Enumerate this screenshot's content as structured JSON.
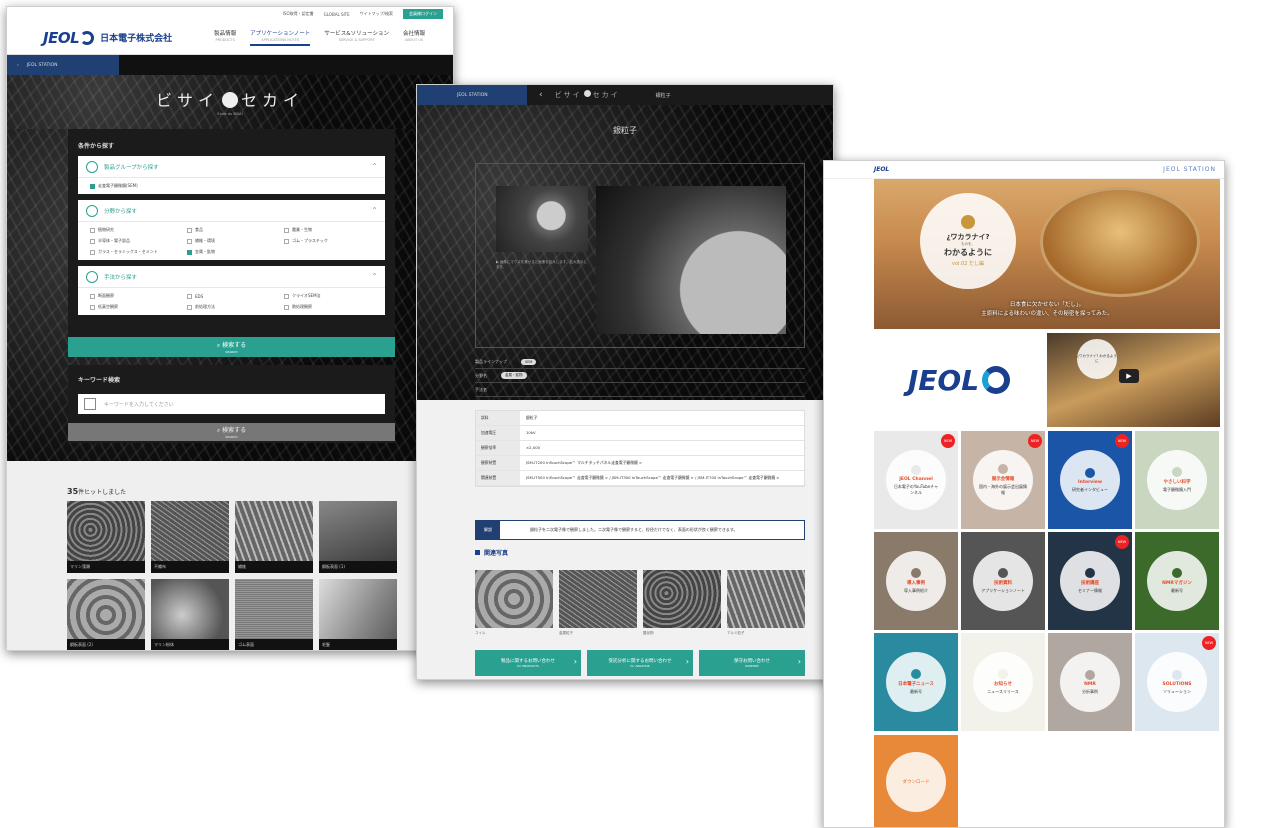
{
  "shot1": {
    "utility": [
      "ISO取得・認定書",
      "GLOBAL SITE",
      "サイトマップ/検索",
      "会員様ログイン"
    ],
    "logo": "JEOL",
    "corp": "日本電子株式会社",
    "nav": [
      {
        "label": "製品情報",
        "sub": "PRODUCTS"
      },
      {
        "label": "アプリケーションノート",
        "sub": "APPLICATIONS NOTES"
      },
      {
        "label": "サービス&ソリューション",
        "sub": "SERVICE & SUPPORT"
      },
      {
        "label": "会社情報",
        "sub": "ABOUT US"
      }
    ],
    "station": "JEOL STATION",
    "hero_left": "ビサイ",
    "hero_right": "セカイ",
    "hero_sub": "Ecole du BISAI",
    "search_title": "条件から探す",
    "acc1": {
      "title": "製品グループから探す",
      "items": [
        "走査電子顕微鏡(SEM)"
      ]
    },
    "acc2": {
      "title": "分野から探す",
      "items": [
        "植物研究",
        "食品",
        "農業・生物",
        "半導体・電子部品",
        "繊維・環境",
        "ゴム・プラスチック",
        "ガラス・セラミックス・セメント",
        "金属・鉱物"
      ]
    },
    "acc3": {
      "title": "手法から探す",
      "items": [
        "断面観察",
        "EDS",
        "クライオSEM法",
        "低真空観察",
        "前処理方法",
        "熱処理観察"
      ]
    },
    "search_btn": "検索する",
    "search_btn_sub": "SEARCH",
    "kw_title": "キーワード検索",
    "kw_placeholder": "キーワードを入力してください",
    "kw_btn": "検索する",
    "kw_btn_sub": "SEARCH",
    "count": "35",
    "count_suffix": "件ヒットしました",
    "thumbs": [
      "マリン藻類",
      "不織布",
      "繊維",
      "鋼板表面 (1)",
      "鋼板表面 (2)",
      "マリン粉体",
      "ゴム表面",
      "毛髪"
    ]
  },
  "shot2": {
    "station": "JEOL STATION",
    "title_left": "ビサイ",
    "title_right": "セカイ",
    "current": "銀粒子",
    "hero_title": "銀粒子",
    "caption": "▶ 画像にマウスを乗せると画像を拡大します。拡大表示します。",
    "meta": [
      {
        "k": "製品ラインナップ",
        "v": "SEM"
      },
      {
        "k": "分野名",
        "v": "金属・鉱物"
      },
      {
        "k": "手法名",
        "v": ""
      }
    ],
    "table": [
      {
        "k": "試料",
        "v": "銀粒子"
      },
      {
        "k": "加速電圧",
        "v": "10kV"
      },
      {
        "k": "観察倍率",
        "v": "×2,000"
      },
      {
        "k": "観察装置",
        "v": "JSM-IT200 InTouchScope™ マルチタッチパネル走査電子顕微鏡 >"
      },
      {
        "k": "関連装置",
        "v": "JSM-IT500 InTouchScope™ 走査電子顕微鏡 > / JSM-IT300 InTouchScope™ 走査電子顕微鏡 > / JSM-IT700 InTouchScope™ 走査電子顕微鏡 >"
      }
    ],
    "note_label": "解説",
    "note": "銀粒子を二次電子像で観察しました。二次電子像で観察すると、粒径だけでなく、表面の形状が良く観察できます。",
    "related": "関連写真",
    "related_items": [
      "コイル",
      "金属粒子",
      "酸化物",
      "アルミ粒子"
    ],
    "buttons": [
      {
        "label": "製品に関するお問い合わせ",
        "sub": "for PRODUCTS"
      },
      {
        "label": "受託分析に関するお問い合わせ",
        "sub": "for ANALYSIS"
      },
      {
        "label": "保守お問い合わせ",
        "sub": "SUPPORT"
      }
    ]
  },
  "shot3": {
    "logo": "JEOL",
    "station": "JEOL STATION",
    "banner": {
      "a": "¿ワカラナイ?",
      "b": "ものを、",
      "c": "わかるように",
      "d": "vol.02 だし編",
      "cap1": "日本食に欠かせない「だし」。",
      "cap2": "主原料による味わいの違い、その秘密を探ってみた。"
    },
    "logo_big": "JEOL",
    "video_text": "¿ワカラナイ? わかるように",
    "cards": [
      {
        "t": "JEOL Channel",
        "s": "日本電子のYouTubeチャンネル",
        "bg": "#e9e9e9",
        "new": true,
        "foot": "JEOL Channel"
      },
      {
        "t": "展示会情報",
        "s": "国内・海外の展示会出展情報",
        "bg": "#c6b4a6",
        "new": true
      },
      {
        "t": "Interview",
        "s": "研究者インタビュー",
        "bg": "#1a55a8",
        "new": true
      },
      {
        "t": "やさしい科学",
        "s": "電子顕微鏡入門",
        "bg": "#c9d6c0",
        "new": false
      },
      {
        "t": "導入事例",
        "s": "導入事例紹介",
        "bg": "#8a7a6a",
        "new": false
      },
      {
        "t": "技術資料",
        "s": "アプリケーションノート",
        "bg": "#555",
        "new": false
      },
      {
        "t": "技術講座",
        "s": "セミナー情報",
        "bg": "#233447",
        "new": true
      },
      {
        "t": "NMRマガジン",
        "s": "最新号",
        "bg": "#3b6a2a",
        "new": false
      },
      {
        "t": "日本電子ニュース",
        "s": "最新号",
        "bg": "#2a8aa0",
        "new": false
      },
      {
        "t": "お知らせ",
        "s": "ニュースリリース",
        "bg": "#f2f2ea",
        "new": false
      },
      {
        "t": "NMR",
        "s": "分析事例",
        "bg": "#b0a8a0",
        "new": false
      },
      {
        "t": "SOLUTIONS",
        "s": "ソリューション",
        "bg": "#dde7f0",
        "new": true
      }
    ],
    "last": "ダウンロード"
  }
}
